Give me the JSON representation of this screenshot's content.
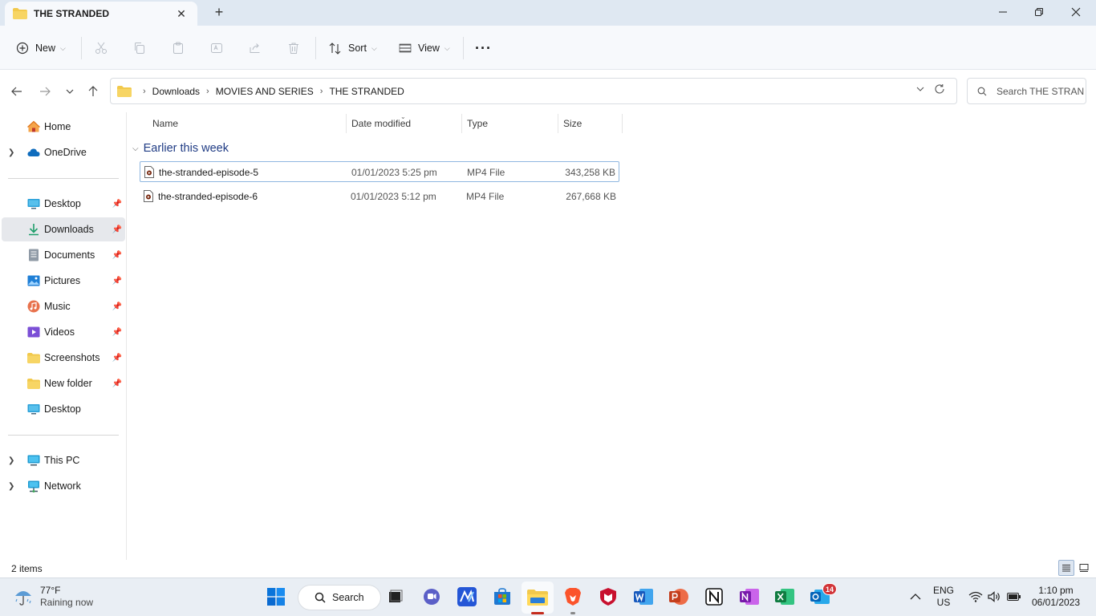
{
  "window": {
    "tab_title": "THE STRANDED",
    "new_tab_symbol": "+",
    "minimize_symbol": "—",
    "close_symbol": "✕"
  },
  "toolbar": {
    "new_label": "New",
    "sort_label": "Sort",
    "view_label": "View",
    "more_label": "···",
    "icons": [
      "plus-circle-icon",
      "cut-icon",
      "copy-icon",
      "paste-icon",
      "rename-icon",
      "share-icon",
      "delete-icon",
      "sort-icon",
      "view-icon"
    ]
  },
  "address": {
    "crumbs": [
      "Downloads",
      "MOVIES AND SERIES",
      "THE STRANDED"
    ],
    "separator": "›"
  },
  "search": {
    "placeholder": "Search THE STRAN..."
  },
  "sidebar": {
    "top": [
      {
        "label": "Home",
        "icon": "home-icon"
      },
      {
        "label": "OneDrive",
        "icon": "cloud-icon"
      }
    ],
    "quick": [
      {
        "label": "Desktop",
        "icon": "desktop-icon",
        "pinned": true
      },
      {
        "label": "Downloads",
        "icon": "download-icon",
        "pinned": true,
        "selected": true
      },
      {
        "label": "Documents",
        "icon": "document-icon",
        "pinned": true
      },
      {
        "label": "Pictures",
        "icon": "pictures-icon",
        "pinned": true
      },
      {
        "label": "Music",
        "icon": "music-icon",
        "pinned": true
      },
      {
        "label": "Videos",
        "icon": "videos-icon",
        "pinned": true
      },
      {
        "label": "Screenshots",
        "icon": "folder-icon",
        "pinned": true
      },
      {
        "label": "New folder",
        "icon": "folder-icon",
        "pinned": true
      },
      {
        "label": "Desktop",
        "icon": "desktop-icon",
        "pinned": false
      }
    ],
    "bottom": [
      {
        "label": "This PC",
        "icon": "pc-icon"
      },
      {
        "label": "Network",
        "icon": "network-icon"
      }
    ]
  },
  "columns": {
    "name": "Name",
    "date": "Date modified",
    "type": "Type",
    "size": "Size"
  },
  "group": {
    "label": "Earlier this week"
  },
  "files": [
    {
      "name": "the-stranded-episode-5",
      "date": "01/01/2023 5:25 pm",
      "type": "MP4 File",
      "size": "343,258 KB",
      "selected": true
    },
    {
      "name": "the-stranded-episode-6",
      "date": "01/01/2023 5:12 pm",
      "type": "MP4 File",
      "size": "267,668 KB",
      "selected": false
    }
  ],
  "status": {
    "item_count": "2 items"
  },
  "taskbar": {
    "weather_temp": "77°F",
    "weather_cond": "Raining now",
    "search_label": "Search",
    "badge_count": "14",
    "lang_top": "ENG",
    "lang_bottom": "US",
    "time": "1:10 pm",
    "date": "06/01/2023",
    "tray_chevron": "︿"
  },
  "colors": {
    "accent": "#0067c0",
    "folder_yellow": "#f2c94c",
    "group_header": "#1f3b84",
    "selection_border": "#8fb7e0"
  }
}
